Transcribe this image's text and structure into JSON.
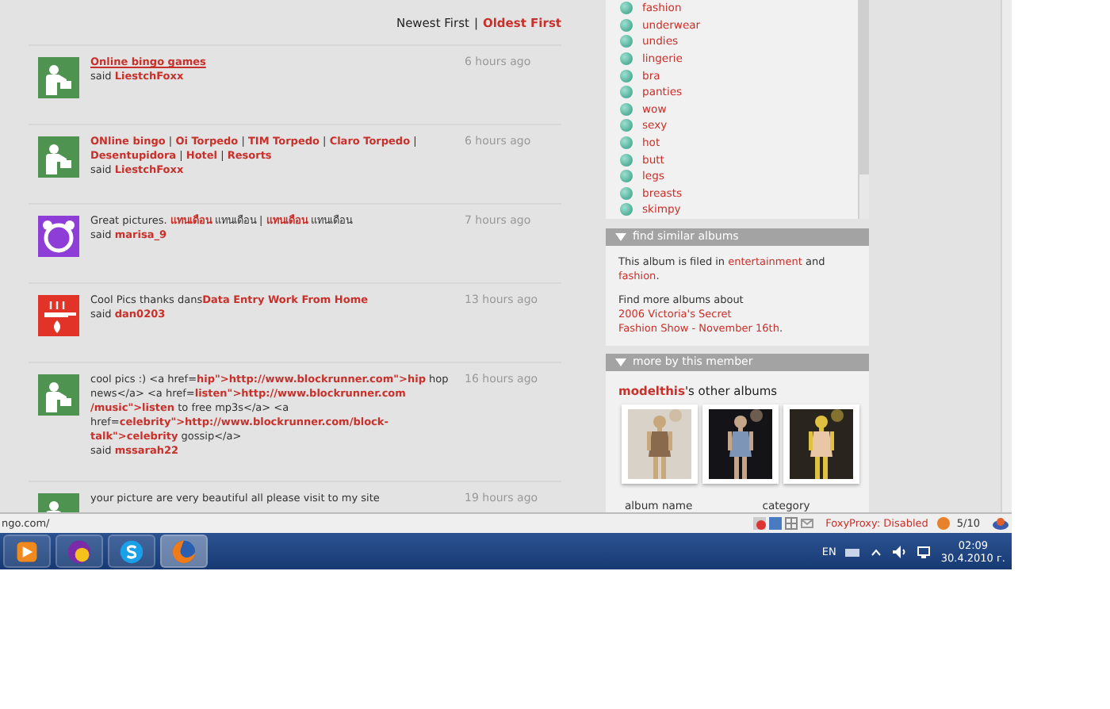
{
  "sort": {
    "options": [
      {
        "label": "Newest First",
        "selected": true
      },
      {
        "label": "Oldest First",
        "selected": false
      }
    ],
    "separator": "|"
  },
  "comments": [
    {
      "kind": "person",
      "body": [
        {
          "kind": "link",
          "text": "Online bingo games"
        }
      ],
      "said": "said",
      "user": "LiestchFoxx",
      "time": "6 hours ago"
    },
    {
      "kind": "person",
      "body": [
        {
          "kind": "link",
          "text": "ONline bingo"
        },
        {
          "kind": "text",
          "text": " | "
        },
        {
          "kind": "link",
          "text": "Oi Torpedo"
        },
        {
          "kind": "text",
          "text": " | "
        },
        {
          "kind": "link",
          "text": "TIM Torpedo"
        },
        {
          "kind": "text",
          "text": " | "
        },
        {
          "kind": "link",
          "text": "Claro Torpedo"
        },
        {
          "kind": "text",
          "text": " | "
        },
        {
          "kind": "link",
          "text": "Desentupidora"
        },
        {
          "kind": "text",
          "text": " | "
        },
        {
          "kind": "link",
          "text": "Hotel"
        },
        {
          "kind": "text",
          "text": " | "
        },
        {
          "kind": "link",
          "text": "Resorts"
        }
      ],
      "said": "said",
      "user": "LiestchFoxx",
      "time": "6 hours ago"
    },
    {
      "kind": "clock",
      "body": [
        {
          "kind": "text",
          "text": "Great pictures. "
        },
        {
          "kind": "link",
          "text": "แทนเดือน"
        },
        {
          "kind": "text",
          "text": " แทนเดือน | "
        },
        {
          "kind": "link",
          "text": "แทนเดือน"
        },
        {
          "kind": "text",
          "text": " แทนเดือน"
        }
      ],
      "said": "said",
      "user": "marisa_9",
      "time": "7 hours ago"
    },
    {
      "kind": "pan",
      "body": [
        {
          "kind": "text",
          "text": "Cool Pics thanks dans"
        },
        {
          "kind": "link",
          "text": "Data Entry Work From Home"
        }
      ],
      "said": "said",
      "user": "dan0203",
      "time": "13 hours ago"
    },
    {
      "kind": "person",
      "body": [
        {
          "kind": "text",
          "text": "cool pics :) <a href="
        },
        {
          "kind": "link",
          "text": "hip\">http://www.blockrunner.com\">hip"
        },
        {
          "kind": "text",
          "text": " hop news</a> <a href="
        },
        {
          "kind": "link",
          "text": "listen\">http://www.blockrunner.com"
        },
        {
          "kind": "break"
        },
        {
          "kind": "link",
          "text": "/music\">listen"
        },
        {
          "kind": "text",
          "text": " to free mp3s</a> <a href="
        },
        {
          "kind": "link",
          "text": "celebrity\">http://www.blockrunner.com/block-"
        },
        {
          "kind": "link",
          "text": "talk\">celebrity"
        },
        {
          "kind": "text",
          "text": " gossip</a>"
        }
      ],
      "said": "said",
      "user": "mssarah22",
      "time": "16 hours ago"
    },
    {
      "kind": "person",
      "body": [
        {
          "kind": "text",
          "text": "your picture are very beautiful all please visit to my site"
        }
      ],
      "time": "19 hours ago"
    }
  ],
  "tags": [
    "fashion",
    "underwear",
    "undies",
    "lingerie",
    "bra",
    "panties",
    "wow",
    "sexy",
    "hot",
    "butt",
    "legs",
    "breasts",
    "skimpy"
  ],
  "similar": {
    "title": "find similar albums",
    "paragraphs": [
      [
        {
          "kind": "text",
          "text": "This album is filed in "
        },
        {
          "kind": "link",
          "text": "entertainment"
        },
        {
          "kind": "text",
          "text": " and "
        },
        {
          "kind": "link",
          "text": "fashion"
        },
        {
          "kind": "text",
          "text": "."
        }
      ],
      [
        {
          "kind": "text",
          "text": "Find more albums about "
        },
        {
          "kind": "link",
          "text": "2006 Victoria's Secret"
        },
        {
          "kind": "break"
        },
        {
          "kind": "link",
          "text": "Fashion Show - November 16th"
        },
        {
          "kind": "text",
          "text": "."
        }
      ]
    ]
  },
  "member": {
    "title": "more by this member",
    "owner": "modelthis",
    "owner_suffix": "'s other albums",
    "thumbnails": [
      {
        "kind": "picture"
      },
      {
        "kind": "picture"
      },
      {
        "kind": "picture"
      }
    ],
    "columns": [
      "album name",
      "category"
    ]
  },
  "status_bar": {
    "url": "ngo.com/",
    "proxy": "FoxyProxy: Disabled",
    "rating": "5/10"
  },
  "taskbar": {
    "apps": [
      {
        "kind": "media",
        "selected": false
      },
      {
        "kind": "messenger",
        "selected": false
      },
      {
        "kind": "skype",
        "selected": false
      },
      {
        "kind": "firefox",
        "selected": true
      }
    ],
    "language": "EN",
    "time": "02:09",
    "date": "30.4.2010 г."
  }
}
